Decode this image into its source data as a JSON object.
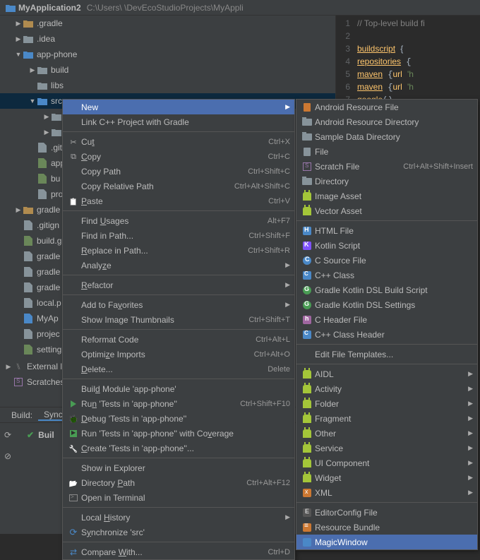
{
  "breadcrumb": {
    "project": "MyApplication2",
    "path": "C:\\Users\\                        \\DevEcoStudioProjects\\MyAppli"
  },
  "tree": {
    "items": [
      {
        "indent": 16,
        "arrow": "▶",
        "icon": "folder-gold",
        "label": ".gradle"
      },
      {
        "indent": 16,
        "arrow": "▶",
        "icon": "folder-dark",
        "label": ".idea"
      },
      {
        "indent": 16,
        "arrow": "▼",
        "icon": "folder-blue",
        "label": "app-phone"
      },
      {
        "indent": 36,
        "arrow": "▶",
        "icon": "folder-dark",
        "label": "build"
      },
      {
        "indent": 36,
        "arrow": "",
        "icon": "folder-dark",
        "label": "libs"
      },
      {
        "indent": 36,
        "arrow": "▼",
        "icon": "folder-blue",
        "label": "src",
        "selected": true
      },
      {
        "indent": 56,
        "arrow": "▶",
        "icon": "folder-dark",
        "label": ""
      },
      {
        "indent": 56,
        "arrow": "▶",
        "icon": "folder-dark",
        "label": ""
      },
      {
        "indent": 36,
        "arrow": "",
        "icon": "file-gray",
        "label": ".giti"
      },
      {
        "indent": 36,
        "arrow": "",
        "icon": "file-green",
        "label": "app"
      },
      {
        "indent": 36,
        "arrow": "",
        "icon": "file-green",
        "label": "bu"
      },
      {
        "indent": 36,
        "arrow": "",
        "icon": "file-gray",
        "label": "pro"
      },
      {
        "indent": 16,
        "arrow": "▶",
        "icon": "folder-gold",
        "label": "gradle"
      },
      {
        "indent": 16,
        "arrow": "",
        "icon": "file-gray",
        "label": ".gitign"
      },
      {
        "indent": 16,
        "arrow": "",
        "icon": "file-green",
        "label": "build.g"
      },
      {
        "indent": 16,
        "arrow": "",
        "icon": "file-gray",
        "label": "gradle"
      },
      {
        "indent": 16,
        "arrow": "",
        "icon": "file-gray",
        "label": "gradle"
      },
      {
        "indent": 16,
        "arrow": "",
        "icon": "file-gray",
        "label": "gradle"
      },
      {
        "indent": 16,
        "arrow": "",
        "icon": "file-gray",
        "label": "local.p"
      },
      {
        "indent": 16,
        "arrow": "",
        "icon": "file-blue",
        "label": "MyAp"
      },
      {
        "indent": 16,
        "arrow": "",
        "icon": "file-gray",
        "label": "projec"
      },
      {
        "indent": 16,
        "arrow": "",
        "icon": "file-green",
        "label": "setting"
      }
    ],
    "external": "External l",
    "scratches": "Scratches"
  },
  "editor": {
    "lines": [
      {
        "n": 1,
        "html": "<span class='cm'>// Top-level build fi</span>"
      },
      {
        "n": 2,
        "html": ""
      },
      {
        "n": 3,
        "html": "<span class='fn ul'>buildscript</span> <span class='br'>{</span>"
      },
      {
        "n": 4,
        "html": "    <span class='fn ul'>repositories</span> {"
      },
      {
        "n": 5,
        "html": "        <span class='fn ul'>maven</span> {<span class='fn'>url</span> <span class='str'>'h</span>"
      },
      {
        "n": 6,
        "html": "        <span class='fn ul'>maven</span> {<span class='fn'>url</span> <span class='str'>'h</span>"
      },
      {
        "n": 7,
        "html": "        <span class='fn'>google</span>()"
      }
    ]
  },
  "bottom": {
    "buildLabel": "Build:",
    "syncTab": "Sync",
    "status": "Buil"
  },
  "context_menu": [
    {
      "type": "item",
      "label": "New",
      "shortcut": "",
      "submenu": true,
      "highlight": true
    },
    {
      "type": "item",
      "label": "Link C++ Project with Gradle",
      "shortcut": ""
    },
    {
      "type": "sep"
    },
    {
      "type": "item",
      "icon": "icon-scissors",
      "label": "Cut",
      "und": "t",
      "pre": "Cu",
      "shortcut": "Ctrl+X"
    },
    {
      "type": "item",
      "icon": "icon-copy",
      "label": "Copy",
      "und": "C",
      "post": "opy",
      "shortcut": "Ctrl+C"
    },
    {
      "type": "item",
      "label": "Copy Path",
      "shortcut": "Ctrl+Shift+C"
    },
    {
      "type": "item",
      "label": "Copy Relative Path",
      "shortcut": "Ctrl+Alt+Shift+C"
    },
    {
      "type": "item",
      "icon": "icon-paste",
      "label": "Paste",
      "und": "P",
      "post": "aste",
      "shortcut": "Ctrl+V"
    },
    {
      "type": "sep"
    },
    {
      "type": "item",
      "label": "Find Usages",
      "und": "U",
      "pre": "Find ",
      "post": "sages",
      "shortcut": "Alt+F7"
    },
    {
      "type": "item",
      "label": "Find in Path...",
      "shortcut": "Ctrl+Shift+F"
    },
    {
      "type": "item",
      "label": "Replace in Path...",
      "und": "R",
      "post": "eplace in Path...",
      "shortcut": "Ctrl+Shift+R"
    },
    {
      "type": "item",
      "label": "Analyze",
      "und": "z",
      "pre": "Analy",
      "post": "e",
      "submenu": true
    },
    {
      "type": "sep"
    },
    {
      "type": "item",
      "label": "Refactor",
      "und": "R",
      "post": "efactor",
      "submenu": true
    },
    {
      "type": "sep"
    },
    {
      "type": "item",
      "label": "Add to Favorites",
      "und": "v",
      "pre": "Add to Fa",
      "post": "orites",
      "submenu": true
    },
    {
      "type": "item",
      "label": "Show Image Thumbnails",
      "shortcut": "Ctrl+Shift+T"
    },
    {
      "type": "sep"
    },
    {
      "type": "item",
      "label": "Reformat Code",
      "shortcut": "Ctrl+Alt+L"
    },
    {
      "type": "item",
      "label": "Optimize Imports",
      "und": "z",
      "pre": "Optimi",
      "post": "e Imports",
      "shortcut": "Ctrl+Alt+O"
    },
    {
      "type": "item",
      "label": "Delete...",
      "und": "D",
      "post": "elete...",
      "shortcut": "Delete"
    },
    {
      "type": "sep"
    },
    {
      "type": "item",
      "label": "Build Module 'app-phone'",
      "und": "d",
      "pre": "Buil",
      "post": " Module 'app-phone'"
    },
    {
      "type": "item",
      "icon": "icon-play",
      "label": "Run 'Tests in 'app-phone''",
      "und": "n",
      "pre": "Ru",
      "post": " 'Tests in 'app-phone''",
      "shortcut": "Ctrl+Shift+F10"
    },
    {
      "type": "item",
      "icon": "icon-bug",
      "label": "Debug 'Tests in 'app-phone''",
      "und": "D",
      "post": "ebug 'Tests in 'app-phone''"
    },
    {
      "type": "item",
      "icon": "icon-coverage",
      "label": "Run 'Tests in 'app-phone'' with Coverage",
      "und": "v",
      "pre": "Run 'Tests in 'app-phone'' with Co",
      "post": "erage"
    },
    {
      "type": "item",
      "icon": "icon-wrench",
      "label": "Create 'Tests in 'app-phone''...",
      "und": "C",
      "post": "reate 'Tests in 'app-phone''..."
    },
    {
      "type": "sep"
    },
    {
      "type": "item",
      "label": "Show in Explorer"
    },
    {
      "type": "item",
      "icon": "icon-folder-open",
      "label": "Directory Path",
      "und": "P",
      "pre": "Directory ",
      "post": "ath",
      "shortcut": "Ctrl+Alt+F12"
    },
    {
      "type": "item",
      "icon": "icon-terminal",
      "label": "Open in Terminal"
    },
    {
      "type": "sep"
    },
    {
      "type": "item",
      "label": "Local History",
      "und": "H",
      "pre": "Local ",
      "post": "istory",
      "submenu": true
    },
    {
      "type": "item",
      "icon": "icon-sync",
      "label": "Synchronize 'src'",
      "und": "y",
      "pre": "S",
      "post": "nchronize 'src'"
    },
    {
      "type": "sep"
    },
    {
      "type": "item",
      "icon": "icon-diff",
      "label": "Compare With...",
      "und": "W",
      "pre": "Compare ",
      "post": "ith...",
      "shortcut": "Ctrl+D"
    }
  ],
  "new_submenu": [
    {
      "type": "item",
      "icon": "ic-file-or",
      "label": "Android Resource File"
    },
    {
      "type": "item",
      "icon": "ic-folder-s",
      "label": "Android Resource Directory"
    },
    {
      "type": "item",
      "icon": "ic-folder-s",
      "label": "Sample Data Directory"
    },
    {
      "type": "item",
      "icon": "ic-file-s",
      "label": "File"
    },
    {
      "type": "item",
      "icon": "icon-scratch",
      "label": "Scratch File",
      "shortcut": "Ctrl+Alt+Shift+Insert"
    },
    {
      "type": "item",
      "icon": "ic-folder-s",
      "label": "Directory"
    },
    {
      "type": "item",
      "icon": "ic-android",
      "label": "Image Asset"
    },
    {
      "type": "item",
      "icon": "ic-android",
      "label": "Vector Asset"
    },
    {
      "type": "sep"
    },
    {
      "type": "item",
      "icon": "ic-html",
      "label": "HTML File"
    },
    {
      "type": "item",
      "icon": "ic-kt",
      "label": "Kotlin Script"
    },
    {
      "type": "item",
      "icon": "ic-c",
      "label": "C Source File"
    },
    {
      "type": "item",
      "icon": "ic-cpp",
      "label": "C++ Class"
    },
    {
      "type": "item",
      "icon": "ic-gradle",
      "label": "Gradle Kotlin DSL Build Script"
    },
    {
      "type": "item",
      "icon": "ic-gradle",
      "label": "Gradle Kotlin DSL Settings"
    },
    {
      "type": "item",
      "icon": "ic-h",
      "label": "C Header File"
    },
    {
      "type": "item",
      "icon": "ic-cpp",
      "label": "C++ Class Header"
    },
    {
      "type": "sep"
    },
    {
      "type": "item",
      "label": "Edit File Templates..."
    },
    {
      "type": "sep"
    },
    {
      "type": "item",
      "icon": "ic-android",
      "label": "AIDL",
      "submenu": true
    },
    {
      "type": "item",
      "icon": "ic-android",
      "label": "Activity",
      "submenu": true
    },
    {
      "type": "item",
      "icon": "ic-android",
      "label": "Folder",
      "submenu": true
    },
    {
      "type": "item",
      "icon": "ic-android",
      "label": "Fragment",
      "submenu": true
    },
    {
      "type": "item",
      "icon": "ic-android",
      "label": "Other",
      "submenu": true
    },
    {
      "type": "item",
      "icon": "ic-android",
      "label": "Service",
      "submenu": true
    },
    {
      "type": "item",
      "icon": "ic-android",
      "label": "UI Component",
      "submenu": true
    },
    {
      "type": "item",
      "icon": "ic-android",
      "label": "Widget",
      "submenu": true
    },
    {
      "type": "item",
      "icon": "ic-xml",
      "label": "XML",
      "submenu": true
    },
    {
      "type": "sep"
    },
    {
      "type": "item",
      "icon": "ic-ec",
      "label": "EditorConfig File"
    },
    {
      "type": "item",
      "icon": "ic-rb",
      "label": "Resource Bundle"
    },
    {
      "type": "item",
      "icon": "ic-mw",
      "label": "MagicWindow",
      "highlight": true
    }
  ]
}
